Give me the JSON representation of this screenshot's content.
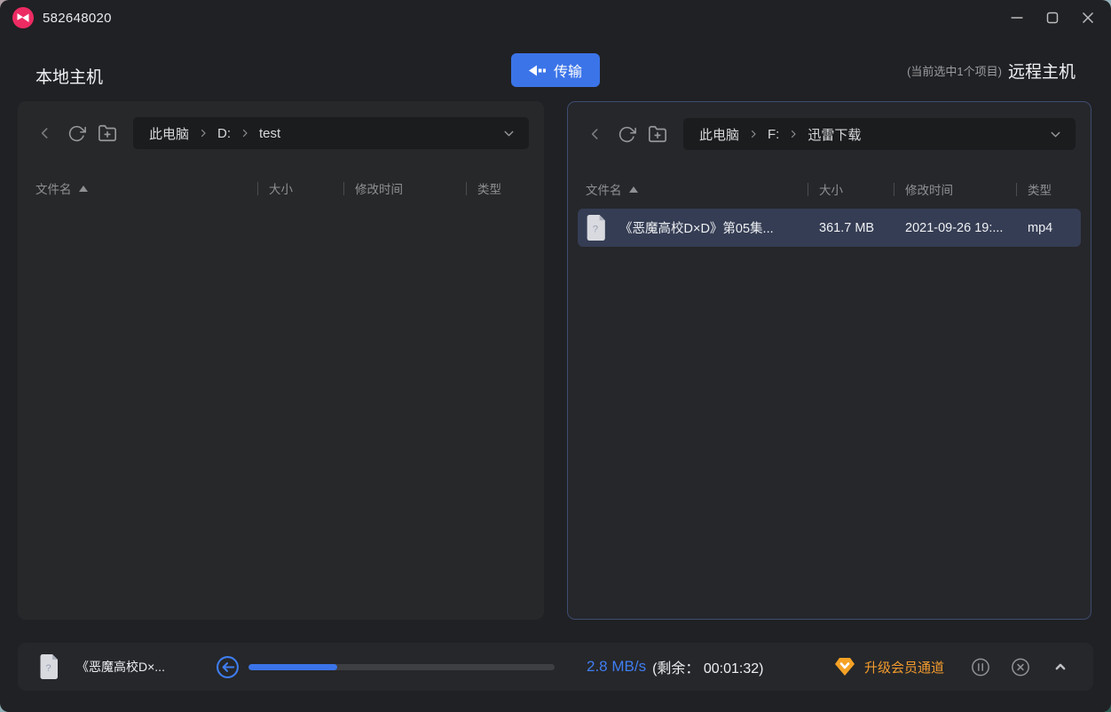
{
  "window": {
    "title": "582648020"
  },
  "header": {
    "local_title": "本地主机",
    "transfer_button": "传输",
    "selection_info": "(当前选中1个项目)",
    "remote_title": "远程主机"
  },
  "columns": {
    "name": "文件名",
    "size": "大小",
    "modified": "修改时间",
    "type": "类型"
  },
  "left_panel": {
    "breadcrumb": {
      "root": "此电脑",
      "drive": "D:",
      "folder": "test"
    },
    "files": []
  },
  "right_panel": {
    "breadcrumb": {
      "root": "此电脑",
      "drive": "F:",
      "folder": "迅雷下载"
    },
    "files": [
      {
        "name": "《恶魔高校D×D》第05集...",
        "size": "361.7 MB",
        "modified": "2021-09-26 19:...",
        "type": "mp4",
        "selected": true
      }
    ]
  },
  "transfer_bar": {
    "filename": "《恶魔高校D×...",
    "speed": "2.8 MB/s",
    "remaining": "(剩余： 00:01:32)",
    "progress_percent": 29,
    "vip_label": "升级会员通道"
  },
  "icons": {
    "logo": "pink-circle-bowtie",
    "transfer": "arrow-left-dashes",
    "direction": "circle-arrow-left",
    "vip": "orange-gem-chevron",
    "file": "document-question"
  },
  "colors": {
    "accent_blue": "#3B74E8",
    "speed_blue": "#3F7DF0",
    "vip_orange": "#F29B2E",
    "selected_row": "#353D54",
    "window_bg": "#202124",
    "panel_bg": "#27282A"
  }
}
